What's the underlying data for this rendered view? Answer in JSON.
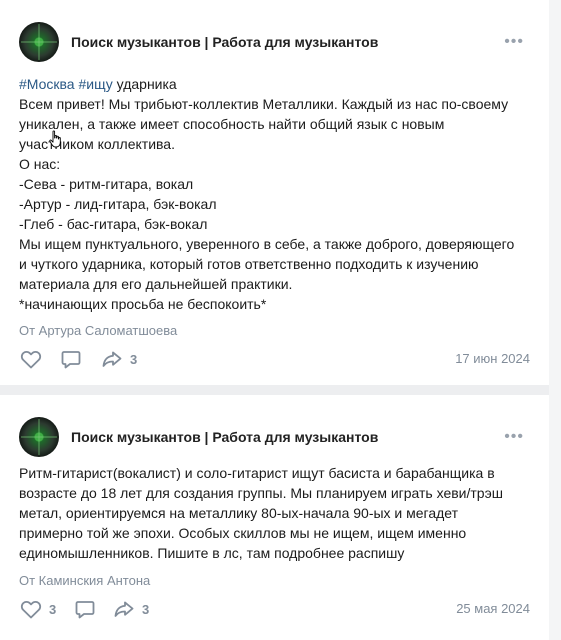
{
  "posts": [
    {
      "group_name": "Поиск музыкантов | Работа для музыкантов",
      "menu_icon": "more-horizontal-icon",
      "hashtag_1": "#Москва",
      "hashtag_2": "#ищу",
      "first_line_rest": "ударника",
      "body_lines": [
        "Всем привет! Мы трибьют-коллектив Металлики. Каждый из нас по-своему",
        "уникален, а также имеет способность найти общий язык с новым",
        "участником коллектива.",
        "О нас:",
        "-Сева - ритм-гитара, вокал",
        "-Артур - лид-гитара, бэк-вокал",
        "-Глеб - бас-гитара, бэк-вокал",
        "Мы ищем пунктуального, уверенного в себе, а также доброго, доверяющего",
        "и чуткого ударника, который готов ответственно подходить к изучению",
        "материала для его дальнейшей практики.",
        "*начинающих просьба не беспокоить*"
      ],
      "author": "От Артура Саломатшоева",
      "likes": "",
      "comments": "",
      "reposts": "3",
      "date": "17 июн 2024"
    },
    {
      "group_name": "Поиск музыкантов | Работа для музыкантов",
      "menu_icon": "more-horizontal-icon",
      "body_lines": [
        "Ритм-гитарист(вокалист) и соло-гитарист ищут басиста и барабанщика в",
        "возрасте до 18 лет для создания группы. Мы планируем играть хеви/трэш",
        "метал, ориентируемся на металлику 80-ых-начала 90-ых и мегадет",
        "примерно той же эпохи. Особых скиллов мы не ищем, ищем именно",
        "единомышленников. Пишите в лс, там подробнее распишу"
      ],
      "author": "От Каминския Антона",
      "likes": "3",
      "comments": "",
      "reposts": "3",
      "date": "25 мая 2024"
    }
  ],
  "icons": {
    "like": "heart-icon",
    "comment": "comment-icon",
    "share": "share-icon",
    "cursor": "hand-pointer-icon"
  },
  "colors": {
    "background": "#edeef0",
    "card": "#ffffff",
    "link": "#2a5885",
    "muted": "#818c99"
  }
}
